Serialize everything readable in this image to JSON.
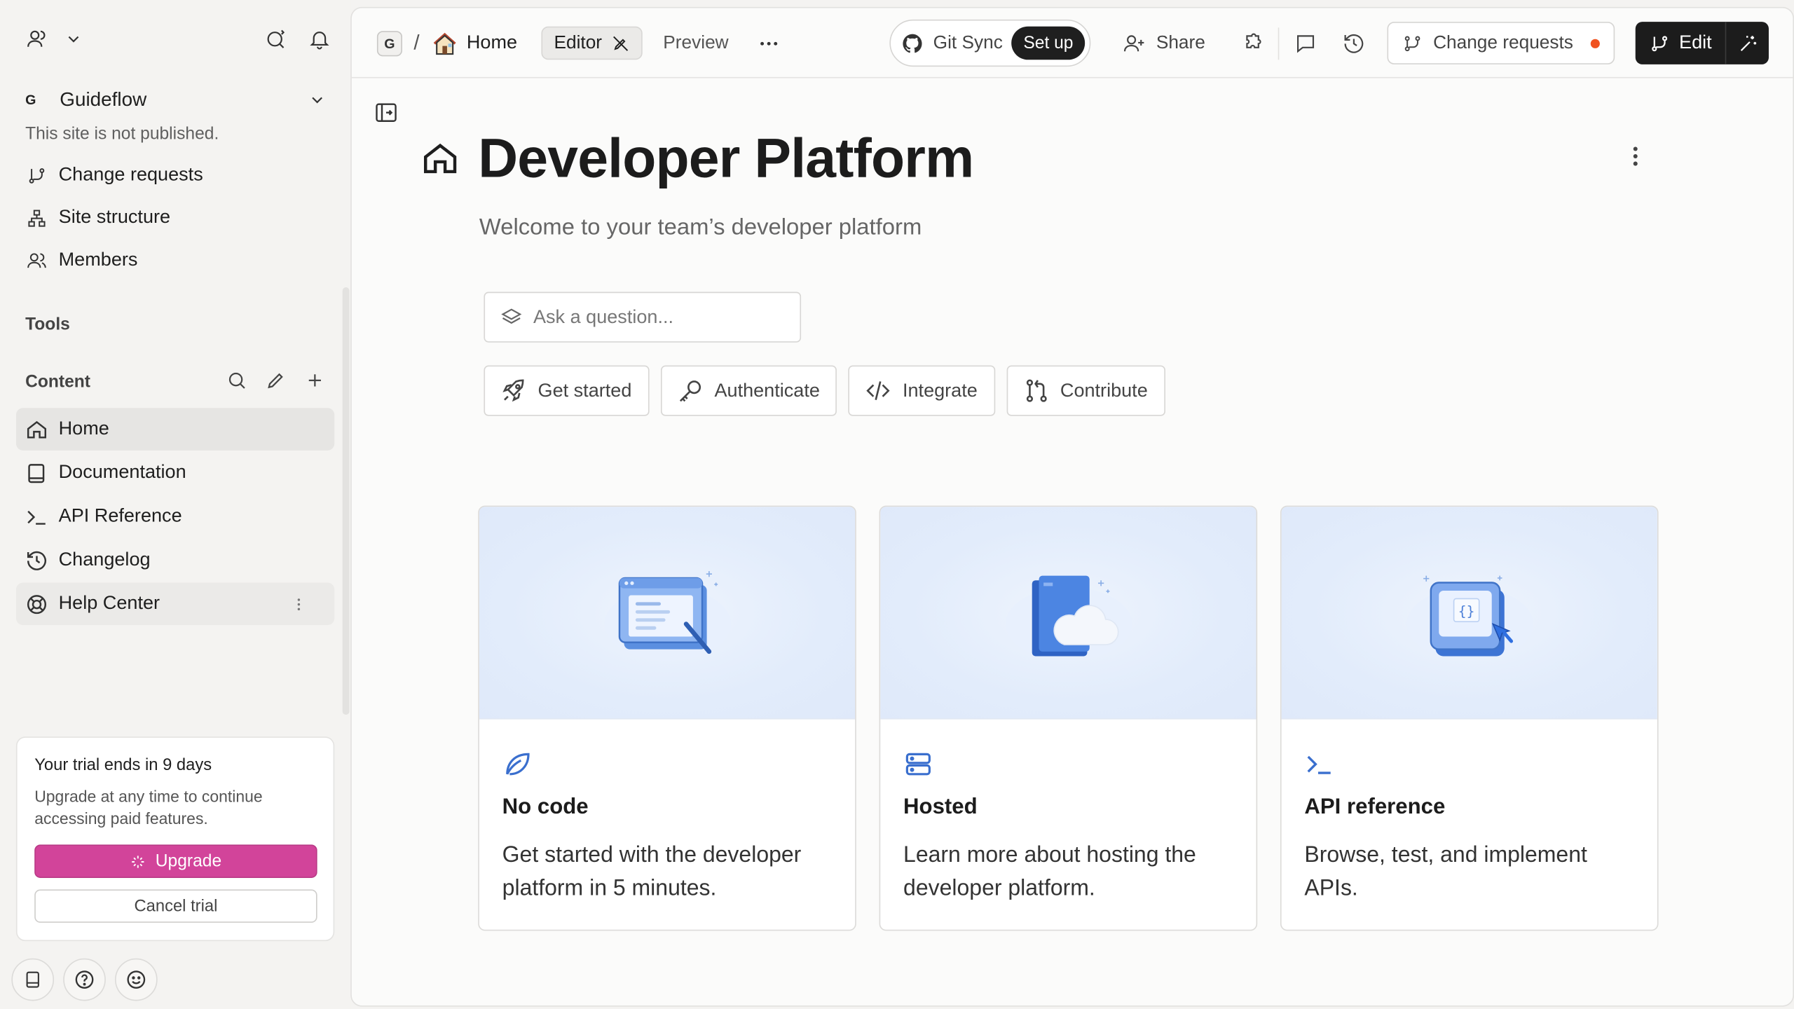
{
  "sidebar": {
    "site": {
      "logo_letter": "G",
      "name": "Guideflow",
      "status": "This site is not published."
    },
    "nav_top": [
      {
        "label": "Change requests",
        "icon": "git-branch-icon"
      },
      {
        "label": "Site structure",
        "icon": "sitemap-icon"
      },
      {
        "label": "Members",
        "icon": "members-icon"
      }
    ],
    "tools_heading": "Tools",
    "content_heading": "Content",
    "content_items": [
      {
        "label": "Home",
        "icon": "home-icon",
        "active": true
      },
      {
        "label": "Documentation",
        "icon": "book-icon"
      },
      {
        "label": "API Reference",
        "icon": "terminal-icon"
      },
      {
        "label": "Changelog",
        "icon": "history-icon"
      },
      {
        "label": "Help Center",
        "icon": "lifebuoy-icon"
      }
    ],
    "trial": {
      "title": "Your trial ends in 9 days",
      "description": "Upgrade at any time to continue accessing paid features.",
      "upgrade_label": "Upgrade",
      "cancel_label": "Cancel trial"
    }
  },
  "topbar": {
    "space_badge": "G",
    "breadcrumb_sep": "/",
    "breadcrumb_page": "Home",
    "editor_tab": "Editor",
    "preview_tab": "Preview",
    "git_sync_label": "Git Sync",
    "git_setup_label": "Set up",
    "share_label": "Share",
    "change_requests_label": "Change requests",
    "edit_label": "Edit"
  },
  "page": {
    "title": "Developer Platform",
    "subtitle": "Welcome to your team’s developer platform",
    "ask_placeholder": "Ask a question...",
    "chips": [
      {
        "label": "Get started",
        "icon": "rocket-icon"
      },
      {
        "label": "Authenticate",
        "icon": "key-icon"
      },
      {
        "label": "Integrate",
        "icon": "code-icon"
      },
      {
        "label": "Contribute",
        "icon": "pull-request-icon"
      }
    ],
    "cards": [
      {
        "title": "No code",
        "description": "Get started with the developer platform in 5 minutes.",
        "icon": "leaf-icon",
        "illustration": "editor-illustration"
      },
      {
        "title": "Hosted",
        "description": "Learn more about hosting the developer platform.",
        "icon": "server-icon",
        "illustration": "cloud-book-illustration"
      },
      {
        "title": "API reference",
        "description": "Browse, test, and implement APIs.",
        "icon": "terminal-icon",
        "illustration": "api-illustration"
      }
    ]
  },
  "colors": {
    "accent_pink": "#d2449a",
    "card_icon_blue": "#3a6fce",
    "notification_dot": "#f0521f"
  }
}
